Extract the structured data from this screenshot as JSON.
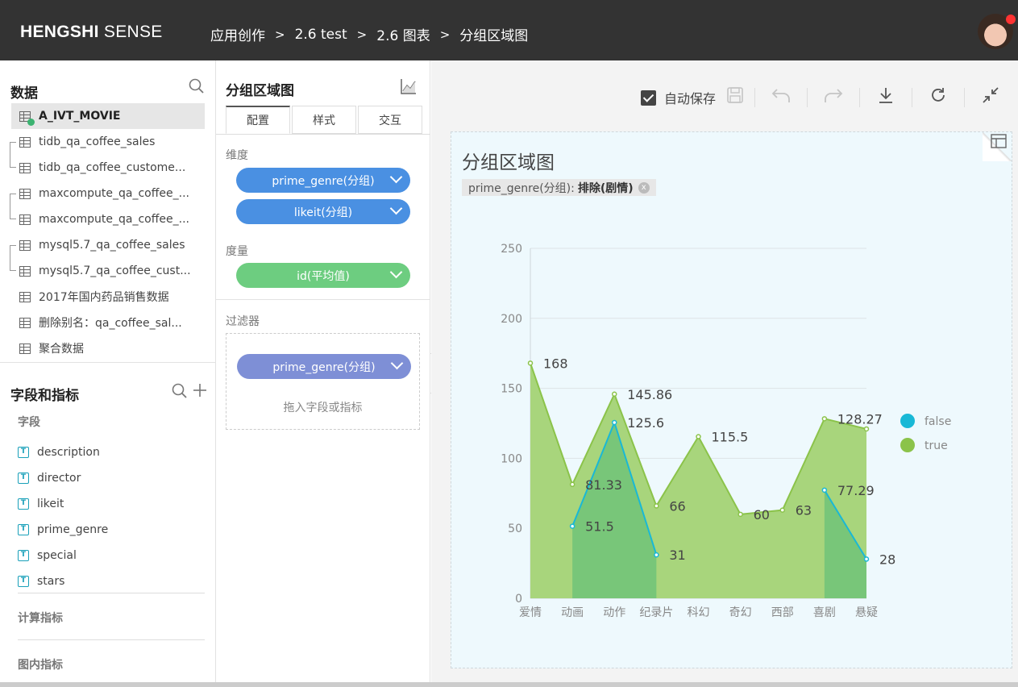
{
  "header": {
    "logo_bold": "HENGSHI",
    "logo_light": " SENSE",
    "breadcrumbs": [
      "应用创作",
      "2.6 test",
      "2.6 图表",
      "分组区域图"
    ],
    "sep": ">"
  },
  "data_panel": {
    "title": "数据",
    "datasets": [
      "A_IVT_MOVIE",
      "tidb_qa_coffee_sales",
      "tidb_qa_coffee_custome...",
      "maxcompute_qa_coffee_...",
      "maxcompute_qa_coffee_...",
      "mysql5.7_qa_coffee_sales",
      "mysql5.7_qa_coffee_cust...",
      "2017年国内药品销售数据",
      "删除别名：qa_coffee_sal...",
      "聚合数据"
    ],
    "fields_title": "字段和指标",
    "fields_sub": "字段",
    "fields": [
      "description",
      "director",
      "likeit",
      "prime_genre",
      "special",
      "stars"
    ],
    "field_type_glyph": "T",
    "calc_title": "计算指标",
    "inner_title": "图内指标"
  },
  "config_panel": {
    "title": "分组区域图",
    "tabs": [
      "配置",
      "样式",
      "交互"
    ],
    "dim_label": "维度",
    "dims": [
      "prime_genre(分组)",
      "likeit(分组)"
    ],
    "measure_label": "度量",
    "measures": [
      "id(平均值)"
    ],
    "filter_label": "过滤器",
    "filters": [
      "prime_genre(分组)"
    ],
    "drop_hint": "拖入字段或指标"
  },
  "toolbar": {
    "autosave_label": "自动保存",
    "autosave_checked": true
  },
  "chart_panel": {
    "title": "分组区域图",
    "filter_field": "prime_genre(分组):",
    "filter_value": "排除(剧情)",
    "filter_close": "x"
  },
  "colors": {
    "false": "#19b8d6",
    "true": "#8bc34a",
    "true_fill": "#a8d57c",
    "false_fill": "#78c679"
  },
  "chart_data": {
    "type": "area",
    "categories": [
      "爱情",
      "动画",
      "动作",
      "纪录片",
      "科幻",
      "奇幻",
      "西部",
      "喜剧",
      "悬疑"
    ],
    "series": [
      {
        "name": "false",
        "values": [
          null,
          51.5,
          125.6,
          31,
          null,
          null,
          null,
          77.29,
          28
        ]
      },
      {
        "name": "true",
        "values": [
          168,
          81.33,
          145.86,
          66,
          115.5,
          60,
          63,
          128.27,
          121
        ]
      }
    ],
    "labels": {
      "true": [
        "168",
        "81.33",
        "145.86",
        "66",
        "115.5",
        "60",
        "63",
        "128.27",
        null
      ],
      "false": [
        null,
        "51.5",
        "125.6",
        "31",
        null,
        null,
        null,
        "77.29",
        "28"
      ]
    },
    "yticks": [
      "0",
      "50",
      "100",
      "150",
      "200",
      "250"
    ],
    "ylim": [
      0,
      250
    ],
    "grid": true,
    "legend": "right"
  }
}
